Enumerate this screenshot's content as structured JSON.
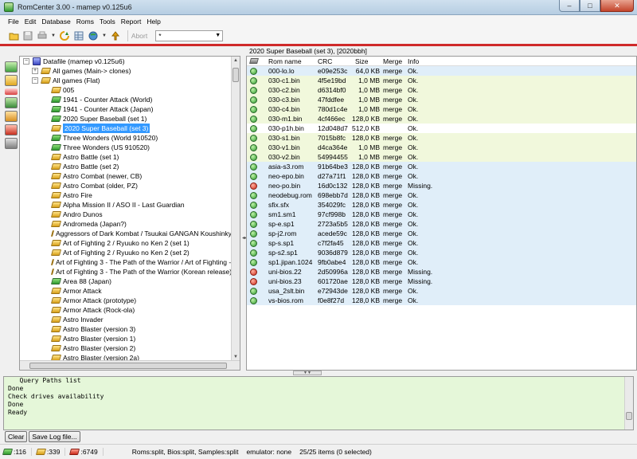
{
  "window": {
    "title": "RomCenter 3.00 - mamep v0.125u6",
    "min": "–",
    "max": "□",
    "close": "✕"
  },
  "menu": [
    "File",
    "Edit",
    "Database",
    "Roms",
    "Tools",
    "Report",
    "Help"
  ],
  "toolbar": {
    "abort_label": "Abort",
    "filter_value": "*"
  },
  "tree": [
    {
      "label": "Datafile (mamep v0.125u6)",
      "indent": 0,
      "expander": "−",
      "icon": "blue"
    },
    {
      "label": "All games (Main-> clones)",
      "indent": 1,
      "expander": "+",
      "icon": "yellow"
    },
    {
      "label": "All games (Flat)",
      "indent": 1,
      "expander": "−",
      "icon": "yellow"
    },
    {
      "label": "005",
      "indent": 2,
      "icon": "yellow"
    },
    {
      "label": "1941 - Counter Attack (World)",
      "indent": 2,
      "icon": "green"
    },
    {
      "label": "1941 - Counter Attack (Japan)",
      "indent": 2,
      "icon": "green"
    },
    {
      "label": "2020 Super Baseball (set 1)",
      "indent": 2,
      "icon": "green"
    },
    {
      "label": "2020 Super Baseball (set 3)",
      "indent": 2,
      "icon": "yellow",
      "state": "selected"
    },
    {
      "label": "Three Wonders (World 910520)",
      "indent": 2,
      "icon": "green"
    },
    {
      "label": "Three Wonders (US 910520)",
      "indent": 2,
      "icon": "green"
    },
    {
      "label": "Astro Battle (set 1)",
      "indent": 2,
      "icon": "yellow"
    },
    {
      "label": "Astro Battle (set 2)",
      "indent": 2,
      "icon": "yellow"
    },
    {
      "label": "Astro Combat (newer, CB)",
      "indent": 2,
      "icon": "yellow"
    },
    {
      "label": "Astro Combat (older, PZ)",
      "indent": 2,
      "icon": "yellow"
    },
    {
      "label": "Astro Fire",
      "indent": 2,
      "icon": "yellow"
    },
    {
      "label": "Alpha Mission II / ASO II - Last Guardian",
      "indent": 2,
      "icon": "yellow"
    },
    {
      "label": "Andro Dunos",
      "indent": 2,
      "icon": "yellow"
    },
    {
      "label": "Andromeda (Japan?)",
      "indent": 2,
      "icon": "yellow"
    },
    {
      "label": "Aggressors of Dark Kombat / Tsuukai GANGAN Koushinkyoku",
      "indent": 2,
      "icon": "yellow"
    },
    {
      "label": "Art of Fighting 2 / Ryuuko no Ken 2 (set 1)",
      "indent": 2,
      "icon": "yellow"
    },
    {
      "label": "Art of Fighting 2 / Ryuuko no Ken 2 (set 2)",
      "indent": 2,
      "icon": "yellow"
    },
    {
      "label": "Art of Fighting 3 - The Path of the Warrior / Art of Fighting - Ryuuko no Ken Gaiden",
      "indent": 2,
      "icon": "yellow"
    },
    {
      "label": "Art of Fighting 3 - The Path of the Warrior (Korean release)",
      "indent": 2,
      "icon": "yellow"
    },
    {
      "label": "Area 88 (Japan)",
      "indent": 2,
      "icon": "green"
    },
    {
      "label": "Armor Attack",
      "indent": 2,
      "icon": "yellow"
    },
    {
      "label": "Armor Attack (prototype)",
      "indent": 2,
      "icon": "yellow"
    },
    {
      "label": "Armor Attack (Rock-ola)",
      "indent": 2,
      "icon": "yellow"
    },
    {
      "label": "Astro Invader",
      "indent": 2,
      "icon": "yellow"
    },
    {
      "label": "Astro Blaster (version 3)",
      "indent": 2,
      "icon": "yellow"
    },
    {
      "label": "Astro Blaster (version 1)",
      "indent": 2,
      "icon": "yellow"
    },
    {
      "label": "Astro Blaster (version 2)",
      "indent": 2,
      "icon": "yellow"
    },
    {
      "label": "Astro Blaster (version 2a)",
      "indent": 2,
      "icon": "yellow"
    }
  ],
  "right_title": "2020 Super Baseball (set 3), [2020bbh]",
  "columns": {
    "name": "Rom name",
    "crc": "CRC",
    "size": "Size",
    "merge": "Merge",
    "info": "Info"
  },
  "roms": [
    {
      "name": "000-lo.lo",
      "crc": "e09e253c",
      "size": "64,0 KB",
      "merge": "merge",
      "info": "Ok.",
      "status": "ok",
      "bg": "blue"
    },
    {
      "name": "030-c1.bin",
      "crc": "4f5e19bd",
      "size": "1,0 MB",
      "merge": "merge",
      "info": "Ok.",
      "status": "ok",
      "bg": "lime"
    },
    {
      "name": "030-c2.bin",
      "crc": "d6314bf0",
      "size": "1,0 MB",
      "merge": "merge",
      "info": "Ok.",
      "status": "ok",
      "bg": "lime"
    },
    {
      "name": "030-c3.bin",
      "crc": "47fddfee",
      "size": "1,0 MB",
      "merge": "merge",
      "info": "Ok.",
      "status": "ok",
      "bg": "lime"
    },
    {
      "name": "030-c4.bin",
      "crc": "780d1c4e",
      "size": "1,0 MB",
      "merge": "merge",
      "info": "Ok.",
      "status": "ok",
      "bg": "lime"
    },
    {
      "name": "030-m1.bin",
      "crc": "4cf466ec",
      "size": "128,0 KB",
      "merge": "merge",
      "info": "Ok.",
      "status": "ok",
      "bg": "lime"
    },
    {
      "name": "030-p1h.bin",
      "crc": "12d048d7",
      "size": "512,0 KB",
      "merge": "",
      "info": "Ok.",
      "status": "ok",
      "bg": "white"
    },
    {
      "name": "030-s1.bin",
      "crc": "7015b8fc",
      "size": "128,0 KB",
      "merge": "merge",
      "info": "Ok.",
      "status": "ok",
      "bg": "lime"
    },
    {
      "name": "030-v1.bin",
      "crc": "d4ca364e",
      "size": "1,0 MB",
      "merge": "merge",
      "info": "Ok.",
      "status": "ok",
      "bg": "lime"
    },
    {
      "name": "030-v2.bin",
      "crc": "54994455",
      "size": "1,0 MB",
      "merge": "merge",
      "info": "Ok.",
      "status": "ok",
      "bg": "lime"
    },
    {
      "name": "asia-s3.rom",
      "crc": "91b64be3",
      "size": "128,0 KB",
      "merge": "merge",
      "info": "Ok.",
      "status": "ok",
      "bg": "blue"
    },
    {
      "name": "neo-epo.bin",
      "crc": "d27a71f1",
      "size": "128,0 KB",
      "merge": "merge",
      "info": "Ok.",
      "status": "ok",
      "bg": "blue"
    },
    {
      "name": "neo-po.bin",
      "crc": "16d0c132",
      "size": "128,0 KB",
      "merge": "merge",
      "info": "Missing.",
      "status": "missing",
      "bg": "blue"
    },
    {
      "name": "neodebug.rom",
      "crc": "698ebb7d",
      "size": "128,0 KB",
      "merge": "merge",
      "info": "Ok.",
      "status": "ok",
      "bg": "blue"
    },
    {
      "name": "sfix.sfx",
      "crc": "354029fc",
      "size": "128,0 KB",
      "merge": "merge",
      "info": "Ok.",
      "status": "ok",
      "bg": "blue"
    },
    {
      "name": "sm1.sm1",
      "crc": "97cf998b",
      "size": "128,0 KB",
      "merge": "merge",
      "info": "Ok.",
      "status": "ok",
      "bg": "blue"
    },
    {
      "name": "sp-e.sp1",
      "crc": "2723a5b5",
      "size": "128,0 KB",
      "merge": "merge",
      "info": "Ok.",
      "status": "ok",
      "bg": "blue"
    },
    {
      "name": "sp-j2.rom",
      "crc": "acede59c",
      "size": "128,0 KB",
      "merge": "merge",
      "info": "Ok.",
      "status": "ok",
      "bg": "blue"
    },
    {
      "name": "sp-s.sp1",
      "crc": "c7f2fa45",
      "size": "128,0 KB",
      "merge": "merge",
      "info": "Ok.",
      "status": "ok",
      "bg": "blue"
    },
    {
      "name": "sp-s2.sp1",
      "crc": "9036d879",
      "size": "128,0 KB",
      "merge": "merge",
      "info": "Ok.",
      "status": "ok",
      "bg": "blue"
    },
    {
      "name": "sp1.jipan.1024",
      "crc": "9fb0abe4",
      "size": "128,0 KB",
      "merge": "merge",
      "info": "Ok.",
      "status": "ok",
      "bg": "blue"
    },
    {
      "name": "uni-bios.22",
      "crc": "2d50996a",
      "size": "128,0 KB",
      "merge": "merge",
      "info": "Missing.",
      "status": "missing",
      "bg": "blue"
    },
    {
      "name": "uni-bios.23",
      "crc": "601720ae",
      "size": "128,0 KB",
      "merge": "merge",
      "info": "Missing.",
      "status": "missing",
      "bg": "blue"
    },
    {
      "name": "usa_2slt.bin",
      "crc": "e72943de",
      "size": "128,0 KB",
      "merge": "merge",
      "info": "Ok.",
      "status": "ok",
      "bg": "blue"
    },
    {
      "name": "vs-bios.rom",
      "crc": "f0e8f27d",
      "size": "128,0 KB",
      "merge": "merge",
      "info": "Ok.",
      "status": "ok",
      "bg": "blue"
    }
  ],
  "log": [
    "   Query Paths list",
    "Done",
    "Check drives availability",
    "Done",
    "Ready"
  ],
  "log_buttons": {
    "clear": "Clear",
    "save": "Save Log file..."
  },
  "status": {
    "green_count": ":116",
    "yellow_count": ":339",
    "red_count": ":6749",
    "modes": "Roms:split, Bios:split, Samples:split",
    "emulator": "emulator: none",
    "items": "25/25 items (0 selected)"
  },
  "colors": {
    "row_blue": "#e0eef9",
    "row_lime": "#f1f8dc",
    "selection": "#3399ff",
    "log_bg": "#e5f7d9",
    "accent_red": "#cf2a2a"
  }
}
